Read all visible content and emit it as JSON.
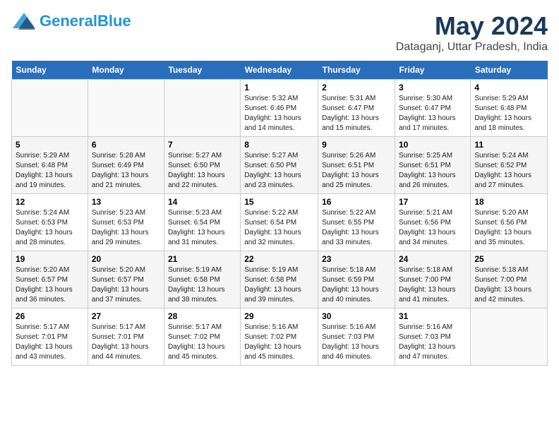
{
  "header": {
    "logo_general": "General",
    "logo_blue": "Blue",
    "main_title": "May 2024",
    "subtitle": "Dataganj, Uttar Pradesh, India"
  },
  "calendar": {
    "days_of_week": [
      "Sunday",
      "Monday",
      "Tuesday",
      "Wednesday",
      "Thursday",
      "Friday",
      "Saturday"
    ],
    "weeks": [
      [
        {
          "day": "",
          "info": ""
        },
        {
          "day": "",
          "info": ""
        },
        {
          "day": "",
          "info": ""
        },
        {
          "day": "1",
          "info": "Sunrise: 5:32 AM\nSunset: 6:46 PM\nDaylight: 13 hours and 14 minutes."
        },
        {
          "day": "2",
          "info": "Sunrise: 5:31 AM\nSunset: 6:47 PM\nDaylight: 13 hours and 15 minutes."
        },
        {
          "day": "3",
          "info": "Sunrise: 5:30 AM\nSunset: 6:47 PM\nDaylight: 13 hours and 17 minutes."
        },
        {
          "day": "4",
          "info": "Sunrise: 5:29 AM\nSunset: 6:48 PM\nDaylight: 13 hours and 18 minutes."
        }
      ],
      [
        {
          "day": "5",
          "info": "Sunrise: 5:29 AM\nSunset: 6:48 PM\nDaylight: 13 hours and 19 minutes."
        },
        {
          "day": "6",
          "info": "Sunrise: 5:28 AM\nSunset: 6:49 PM\nDaylight: 13 hours and 21 minutes."
        },
        {
          "day": "7",
          "info": "Sunrise: 5:27 AM\nSunset: 6:50 PM\nDaylight: 13 hours and 22 minutes."
        },
        {
          "day": "8",
          "info": "Sunrise: 5:27 AM\nSunset: 6:50 PM\nDaylight: 13 hours and 23 minutes."
        },
        {
          "day": "9",
          "info": "Sunrise: 5:26 AM\nSunset: 6:51 PM\nDaylight: 13 hours and 25 minutes."
        },
        {
          "day": "10",
          "info": "Sunrise: 5:25 AM\nSunset: 6:51 PM\nDaylight: 13 hours and 26 minutes."
        },
        {
          "day": "11",
          "info": "Sunrise: 5:24 AM\nSunset: 6:52 PM\nDaylight: 13 hours and 27 minutes."
        }
      ],
      [
        {
          "day": "12",
          "info": "Sunrise: 5:24 AM\nSunset: 6:53 PM\nDaylight: 13 hours and 28 minutes."
        },
        {
          "day": "13",
          "info": "Sunrise: 5:23 AM\nSunset: 6:53 PM\nDaylight: 13 hours and 29 minutes."
        },
        {
          "day": "14",
          "info": "Sunrise: 5:23 AM\nSunset: 6:54 PM\nDaylight: 13 hours and 31 minutes."
        },
        {
          "day": "15",
          "info": "Sunrise: 5:22 AM\nSunset: 6:54 PM\nDaylight: 13 hours and 32 minutes."
        },
        {
          "day": "16",
          "info": "Sunrise: 5:22 AM\nSunset: 6:55 PM\nDaylight: 13 hours and 33 minutes."
        },
        {
          "day": "17",
          "info": "Sunrise: 5:21 AM\nSunset: 6:56 PM\nDaylight: 13 hours and 34 minutes."
        },
        {
          "day": "18",
          "info": "Sunrise: 5:20 AM\nSunset: 6:56 PM\nDaylight: 13 hours and 35 minutes."
        }
      ],
      [
        {
          "day": "19",
          "info": "Sunrise: 5:20 AM\nSunset: 6:57 PM\nDaylight: 13 hours and 36 minutes."
        },
        {
          "day": "20",
          "info": "Sunrise: 5:20 AM\nSunset: 6:57 PM\nDaylight: 13 hours and 37 minutes."
        },
        {
          "day": "21",
          "info": "Sunrise: 5:19 AM\nSunset: 6:58 PM\nDaylight: 13 hours and 38 minutes."
        },
        {
          "day": "22",
          "info": "Sunrise: 5:19 AM\nSunset: 6:58 PM\nDaylight: 13 hours and 39 minutes."
        },
        {
          "day": "23",
          "info": "Sunrise: 5:18 AM\nSunset: 6:59 PM\nDaylight: 13 hours and 40 minutes."
        },
        {
          "day": "24",
          "info": "Sunrise: 5:18 AM\nSunset: 7:00 PM\nDaylight: 13 hours and 41 minutes."
        },
        {
          "day": "25",
          "info": "Sunrise: 5:18 AM\nSunset: 7:00 PM\nDaylight: 13 hours and 42 minutes."
        }
      ],
      [
        {
          "day": "26",
          "info": "Sunrise: 5:17 AM\nSunset: 7:01 PM\nDaylight: 13 hours and 43 minutes."
        },
        {
          "day": "27",
          "info": "Sunrise: 5:17 AM\nSunset: 7:01 PM\nDaylight: 13 hours and 44 minutes."
        },
        {
          "day": "28",
          "info": "Sunrise: 5:17 AM\nSunset: 7:02 PM\nDaylight: 13 hours and 45 minutes."
        },
        {
          "day": "29",
          "info": "Sunrise: 5:16 AM\nSunset: 7:02 PM\nDaylight: 13 hours and 45 minutes."
        },
        {
          "day": "30",
          "info": "Sunrise: 5:16 AM\nSunset: 7:03 PM\nDaylight: 13 hours and 46 minutes."
        },
        {
          "day": "31",
          "info": "Sunrise: 5:16 AM\nSunset: 7:03 PM\nDaylight: 13 hours and 47 minutes."
        },
        {
          "day": "",
          "info": ""
        }
      ]
    ]
  }
}
